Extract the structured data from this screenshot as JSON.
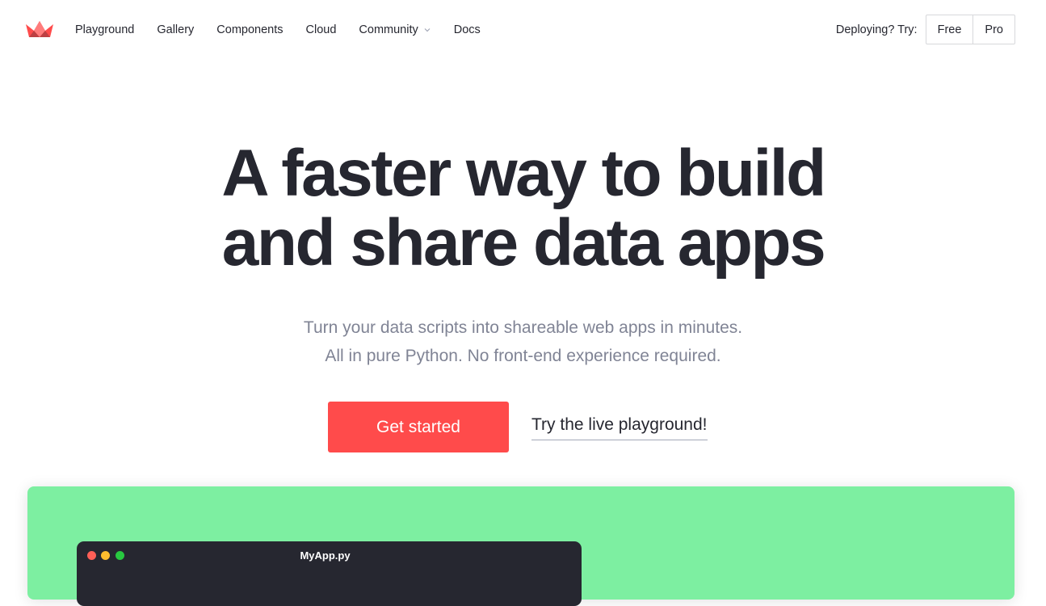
{
  "brand": {
    "logo_icon": "streamlit-crown-icon",
    "color": "#ff4b4b"
  },
  "nav": {
    "items": [
      {
        "label": "Playground"
      },
      {
        "label": "Gallery"
      },
      {
        "label": "Components"
      },
      {
        "label": "Cloud"
      },
      {
        "label": "Community",
        "icon": "chevron-down-icon"
      },
      {
        "label": "Docs"
      }
    ],
    "deploy_label": "Deploying? Try:",
    "deploy_options": [
      "Free",
      "Pro"
    ]
  },
  "hero": {
    "title_line1": "A faster way to build",
    "title_line2": "and share data apps",
    "subtitle_line1": "Turn your data scripts into shareable web apps in minutes.",
    "subtitle_line2": "All in pure Python. No front-end experience required.",
    "cta_label": "Get started",
    "secondary_link": "Try the live playground!"
  },
  "demo": {
    "panel_color": "#7defa1",
    "window_title": "MyApp.py"
  }
}
